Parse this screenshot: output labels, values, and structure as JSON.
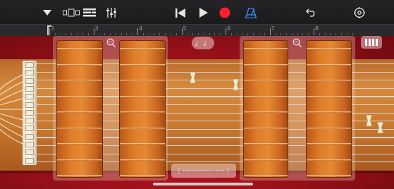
{
  "toolbar": {
    "icons": [
      "dropdown-arrow-icon",
      "view-toggle-icon",
      "tracks-icon",
      "mixer-icon",
      "skip-back-icon",
      "play-icon",
      "record-icon",
      "metronome-icon",
      "undo-icon",
      "settings-icon"
    ],
    "record_color": "#ff1f2d",
    "metronome_color": "#3b82f6"
  },
  "ruler": {
    "marks": [
      "2",
      "3",
      "4",
      "5",
      "6",
      "7",
      "8"
    ]
  },
  "instrument": {
    "strings_count": 13,
    "body_color": "#b8141e",
    "wood_color": "#d98a3d"
  },
  "center_chip": {
    "symbol": "♩♩"
  },
  "bottom_chip": {
    "symbol": "⋮⋯⋯⋯⋯⋯⋯⋮"
  },
  "keyboard_chip": {
    "icon": "keyboard-icon"
  }
}
